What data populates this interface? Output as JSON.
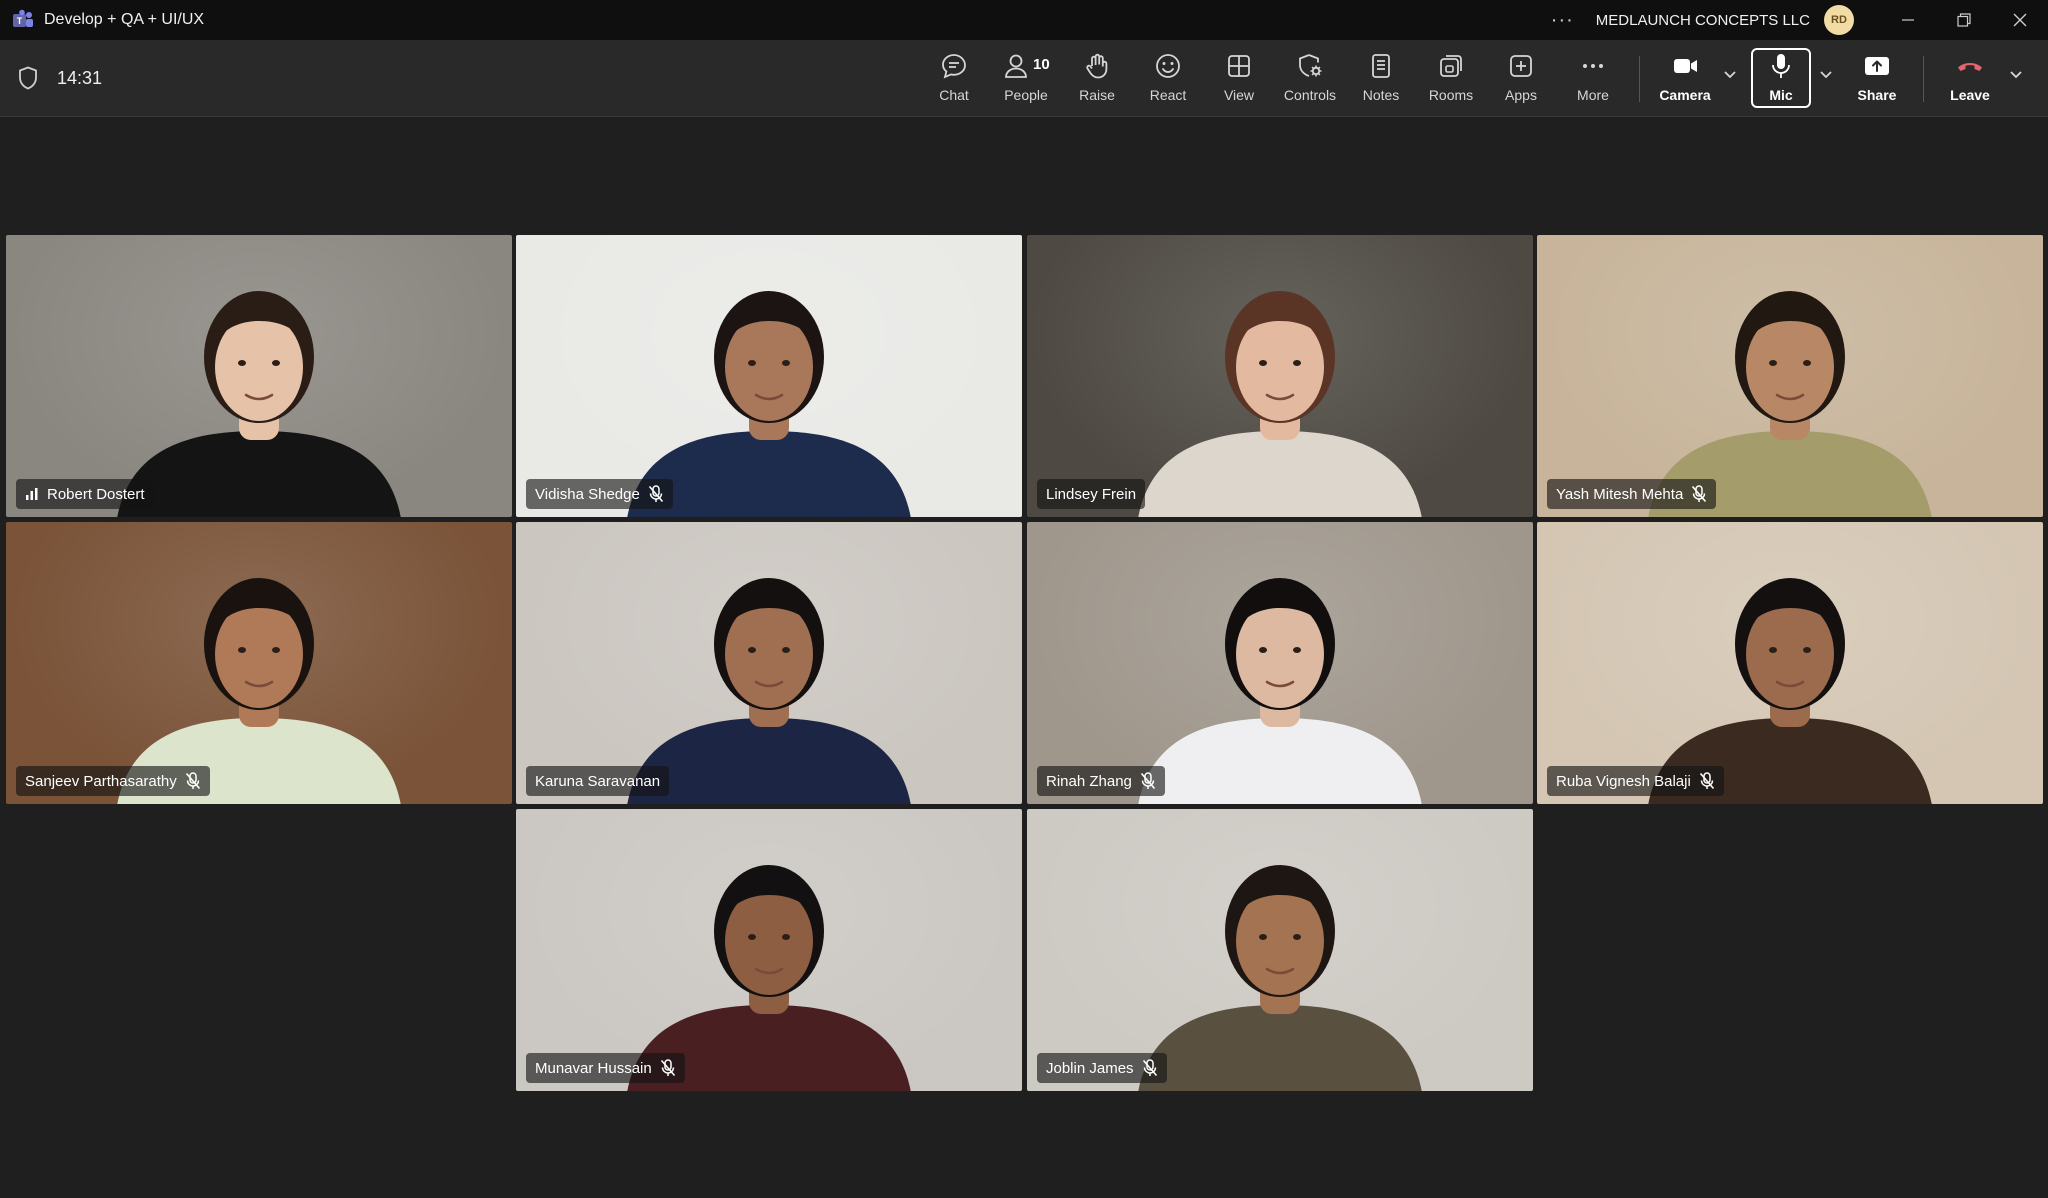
{
  "window": {
    "title": "Develop + QA + UI/UX",
    "org": "MEDLAUNCH CONCEPTS LLC",
    "avatar_initials": "RD"
  },
  "meeting": {
    "elapsed": "14:31",
    "people_count": "10"
  },
  "toolbar": {
    "chat": "Chat",
    "people": "People",
    "raise": "Raise",
    "react": "React",
    "view": "View",
    "controls": "Controls",
    "notes": "Notes",
    "rooms": "Rooms",
    "apps": "Apps",
    "more": "More",
    "camera": "Camera",
    "mic": "Mic",
    "share": "Share",
    "leave": "Leave"
  },
  "participants": [
    {
      "name": "Robert Dostert",
      "muted": false,
      "speaking": true,
      "bg": "#8a8680",
      "skin": "#e6c2a8",
      "hair": "#2a1d16",
      "shirt": "#141414"
    },
    {
      "name": "Vidisha Shedge",
      "muted": true,
      "speaking": false,
      "bg": "#e9eae6",
      "skin": "#a9775a",
      "hair": "#1b1412",
      "shirt": "#1d2c4d"
    },
    {
      "name": "Lindsey Frein",
      "muted": false,
      "speaking": false,
      "bg": "#4e4a43",
      "skin": "#e3b9a0",
      "hair": "#5a3424",
      "shirt": "#dcd6cc"
    },
    {
      "name": "Yash Mitesh Mehta",
      "muted": true,
      "speaking": false,
      "bg": "#c7b49a",
      "skin": "#b88866",
      "hair": "#221812",
      "shirt": "#a59c6c"
    },
    {
      "name": "Sanjeev Parthasarathy",
      "muted": true,
      "speaking": false,
      "bg": "#7a5338",
      "skin": "#b07a58",
      "hair": "#1a120e",
      "shirt": "#dde4cc"
    },
    {
      "name": "Karuna Saravanan",
      "muted": false,
      "speaking": false,
      "bg": "#cbc6c0",
      "skin": "#a06f52",
      "hair": "#151010",
      "shirt": "#1d2544"
    },
    {
      "name": "Rinah Zhang",
      "muted": true,
      "speaking": false,
      "bg": "#9f978c",
      "skin": "#dcb9a0",
      "hair": "#120e0e",
      "shirt": "#efeff1"
    },
    {
      "name": "Ruba Vignesh Balaji",
      "muted": true,
      "speaking": false,
      "bg": "#d4c6b3",
      "skin": "#9c6a4c",
      "hair": "#141010",
      "shirt": "#3a2a20"
    },
    {
      "name": "Munavar Hussain",
      "muted": true,
      "speaking": false,
      "bg": "#cbc7c2",
      "skin": "#8d5e42",
      "hair": "#121010",
      "shirt": "#4a1f22"
    },
    {
      "name": "Joblin James",
      "muted": true,
      "speaking": false,
      "bg": "#cdc9c3",
      "skin": "#a37352",
      "hair": "#1d1612",
      "shirt": "#5a5040"
    }
  ]
}
